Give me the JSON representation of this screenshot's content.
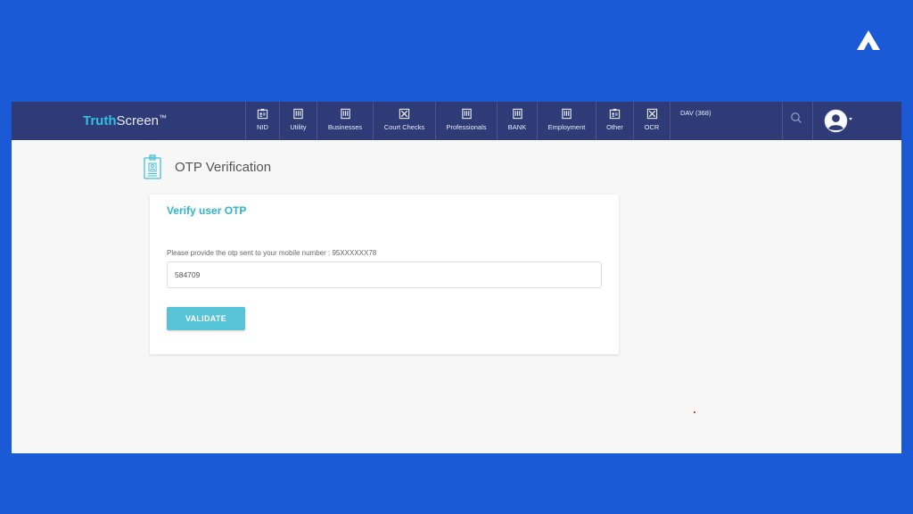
{
  "brand": {
    "part1": "Truth",
    "part2": "Screen",
    "trademark": "™"
  },
  "nav": {
    "items": [
      {
        "label": "NID",
        "icon": "id-card-icon"
      },
      {
        "label": "Utility",
        "icon": "document-icon"
      },
      {
        "label": "Businesses",
        "icon": "document-icon"
      },
      {
        "label": "Court Checks",
        "icon": "gavel-box-icon"
      },
      {
        "label": "Professionals",
        "icon": "document-icon"
      },
      {
        "label": "BANK",
        "icon": "document-icon"
      },
      {
        "label": "Employment",
        "icon": "document-icon"
      },
      {
        "label": "Other",
        "icon": "id-card-icon"
      },
      {
        "label": "OCR",
        "icon": "gavel-box-icon"
      }
    ],
    "account": "DAV (368)"
  },
  "page": {
    "title": "OTP Verification",
    "icon": "id-badge-icon"
  },
  "card": {
    "title": "Verify user OTP",
    "label": "Please provide the otp sent to your mobile number : 95XXXXXX78",
    "otp_value": "584709",
    "button": "VALIDATE"
  },
  "colors": {
    "frame": "#1a5ad7",
    "navbar": "#2f3b77",
    "accent": "#31b3cf",
    "button": "#57c3d6"
  }
}
